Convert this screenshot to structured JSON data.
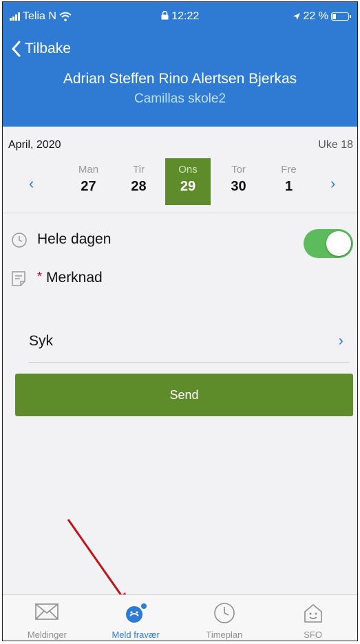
{
  "status": {
    "carrier": "Telia N",
    "time": "12:22",
    "battery_text": "22 %",
    "battery_level": 0.22
  },
  "header": {
    "back_label": "Tilbake",
    "student_name": "Adrian Steffen Rino Alertsen Bjerkas",
    "school": "Camillas skole2"
  },
  "calendar": {
    "month": "April, 2020",
    "week": "Uke 18",
    "prev": "‹",
    "next": "›",
    "days": [
      {
        "name": "Man",
        "date": "27"
      },
      {
        "name": "Tir",
        "date": "28"
      },
      {
        "name": "Ons",
        "date": "29"
      },
      {
        "name": "Tor",
        "date": "30"
      },
      {
        "name": "Fre",
        "date": "1"
      }
    ],
    "selected_index": 2
  },
  "form": {
    "whole_day_label": "Hele dagen",
    "whole_day_on": true,
    "note_required_mark": "*",
    "note_label": "Merknad",
    "reason_value": "Syk",
    "reason_chevron": "›",
    "send_label": "Send"
  },
  "tabs": [
    {
      "label": "Meldinger",
      "icon": "envelope-icon"
    },
    {
      "label": "Meld fravær",
      "icon": "report-absence-icon"
    },
    {
      "label": "Timeplan",
      "icon": "clock-icon"
    },
    {
      "label": "SFO",
      "icon": "house-icon"
    }
  ],
  "active_tab": 1,
  "colors": {
    "header_blue": "#2f7bd4",
    "selected_green": "#5f8c2a",
    "toggle_green": "#5cbb5c",
    "annotation_red": "#c0141a"
  }
}
